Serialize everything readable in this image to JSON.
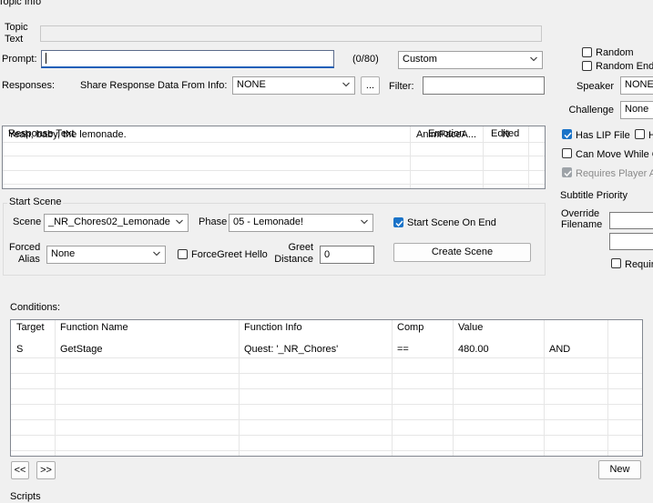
{
  "window": {
    "title": "Topic Info"
  },
  "topic": {
    "label_line1": "Topic",
    "label_line2": "Text",
    "value": ""
  },
  "prompt": {
    "label": "Prompt:",
    "value": "",
    "counter": "(0/80)",
    "type_value": "Custom"
  },
  "responses": {
    "label": "Responses:",
    "share_label": "Share Response Data From Info:",
    "share_value": "NONE",
    "ellipsis": "...",
    "filter_label": "Filter:",
    "filter_value": "",
    "columns": [
      "Response Text",
      "Emotion",
      "Edited"
    ],
    "rows": [
      {
        "text": "Yeah, baby, the lemonade.",
        "emotion": "AnimFaceA...",
        "edited": "N"
      }
    ]
  },
  "start_scene": {
    "title": "Start Scene",
    "scene_label": "Scene",
    "scene_value": "_NR_Chores02_Lemonade",
    "phase_label": "Phase",
    "phase_value": "05 - Lemonade!",
    "start_on_end_label": "Start Scene On End",
    "start_on_end_checked": true,
    "forced_alias_line1": "Forced",
    "forced_alias_line2": "Alias",
    "forced_alias_value": "None",
    "forcegreet_label": "ForceGreet Hello",
    "forcegreet_checked": false,
    "greet_line1": "Greet",
    "greet_line2": "Distance",
    "greet_value": "0",
    "create_button": "Create Scene"
  },
  "right_panel": {
    "random_label": "Random",
    "random_end_label": "Random End",
    "speaker_label": "Speaker",
    "speaker_value": "NONE",
    "challenge_label": "Challenge",
    "challenge_value": "None",
    "has_lip_label": "Has LIP File",
    "has_lip_checked": true,
    "h_label": "H",
    "can_move_label": "Can Move While G",
    "requires_player_label": "Requires Player A",
    "subtitle_priority_label": "Subtitle Priority",
    "override_line1": "Override",
    "override_line2": "Filename",
    "requir_label": "Requir"
  },
  "conditions": {
    "label": "Conditions:",
    "columns": [
      "Target",
      "Function Name",
      "Function Info",
      "Comp",
      "Value",
      ""
    ],
    "rows": [
      {
        "target": "S",
        "function": "GetStage",
        "info": "Quest: '_NR_Chores'",
        "comp": "==",
        "value": "480.00",
        "op": "AND"
      }
    ],
    "prev_button": "<<",
    "next_button": ">>",
    "new_button": "New"
  },
  "scripts": {
    "label": "Scripts"
  }
}
